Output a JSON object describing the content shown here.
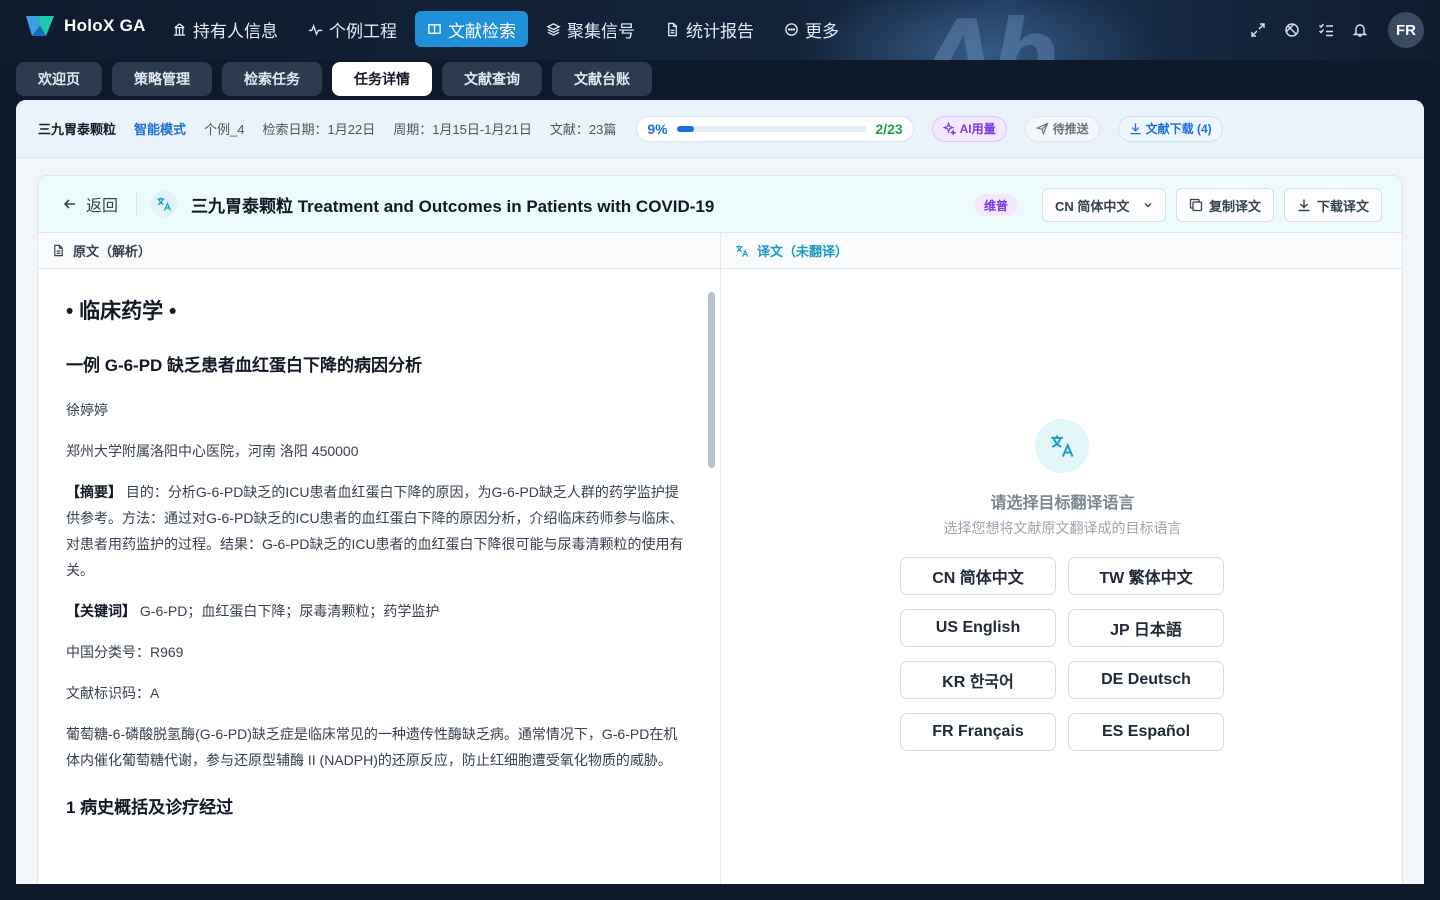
{
  "app": {
    "name": "HoloX GA",
    "avatar": "FR"
  },
  "nav": [
    {
      "label": "持有人信息",
      "icon": "building-icon",
      "active": false
    },
    {
      "label": "个例工程",
      "icon": "pulse-icon",
      "active": false
    },
    {
      "label": "文献检索",
      "icon": "book-icon",
      "active": true
    },
    {
      "label": "聚集信号",
      "icon": "layers-icon",
      "active": false
    },
    {
      "label": "统计报告",
      "icon": "report-icon",
      "active": false
    },
    {
      "label": "更多",
      "icon": "more-circle-icon",
      "active": false
    }
  ],
  "tabs": [
    {
      "label": "欢迎页",
      "active": false
    },
    {
      "label": "策略管理",
      "active": false
    },
    {
      "label": "检索任务",
      "active": false
    },
    {
      "label": "任务详情",
      "active": true
    },
    {
      "label": "文献查询",
      "active": false
    },
    {
      "label": "文献台账",
      "active": false
    }
  ],
  "task": {
    "drug": "三九胃泰颗粒",
    "mode": "智能模式",
    "case": "个例_4",
    "search_date": "检索日期：1月22日",
    "period": "周期：1月15日-1月21日",
    "docs": "文献：23篇",
    "progress_pct": "9%",
    "progress_value": 0.09,
    "progress_count": "2/23",
    "ai_label": "AI用量",
    "push_label": "待推送",
    "download_label": "文献下载 (4)"
  },
  "doc": {
    "back_label": "返回",
    "title": "三九胃泰颗粒 Treatment and Outcomes in Patients with COVID-19",
    "lang_tag": "维普",
    "target_lang": "CN 简体中文",
    "copy_label": "复制译文",
    "download_label": "下载译文",
    "left_header": "原文（解析）",
    "right_header": "译文（未翻译）"
  },
  "original": {
    "section": "• 临床药学 •",
    "title": "一例 G-6-PD 缺乏患者血红蛋白下降的病因分析",
    "author": "徐婷婷",
    "affiliation": "郑州大学附属洛阳中心医院，河南 洛阳 450000",
    "abstract_label": "【摘要】",
    "abstract": " 目的：分析G-6-PD缺乏的ICU患者血红蛋白下降的原因，为G-6-PD缺乏人群的药学监护提供参考。方法：通过对G-6-PD缺乏的ICU患者的血红蛋白下降的原因分析，介绍临床药师参与临床、对患者用药监护的过程。结果：G-6-PD缺乏的ICU患者的血红蛋白下降很可能与尿毒清颗粒的使用有关。",
    "keywords_label": "【关键词】",
    "keywords": " G-6-PD；血红蛋白下降；尿毒清颗粒；药学监护",
    "class_no": "中国分类号：R969",
    "doc_code": "文献标识码：A",
    "para1": "葡萄糖-6-磷酸脱氢酶(G-6-PD)缺乏症是临床常见的一种遗传性酶缺乏病。通常情况下，G-6-PD在机体内催化葡萄糖代谢，参与还原型辅酶 II (NADPH)的还原反应，防止红细胞遭受氧化物质的威胁。",
    "section1": "1 病史概括及诊疗经过"
  },
  "translation": {
    "empty_title": "请选择目标翻译语言",
    "empty_sub": "选择您想将文献原文翻译成的目标语言",
    "languages": [
      "CN 简体中文",
      "TW 繁体中文",
      "US English",
      "JP 日本語",
      "KR 한국어",
      "DE Deutsch",
      "FR Français",
      "ES Español"
    ]
  },
  "colors": {
    "accent": "#1f8fd8",
    "progress": "#1d6fe0",
    "success": "#16a34a",
    "ai": "#7c3aed",
    "translate": "#1b9bc7"
  }
}
